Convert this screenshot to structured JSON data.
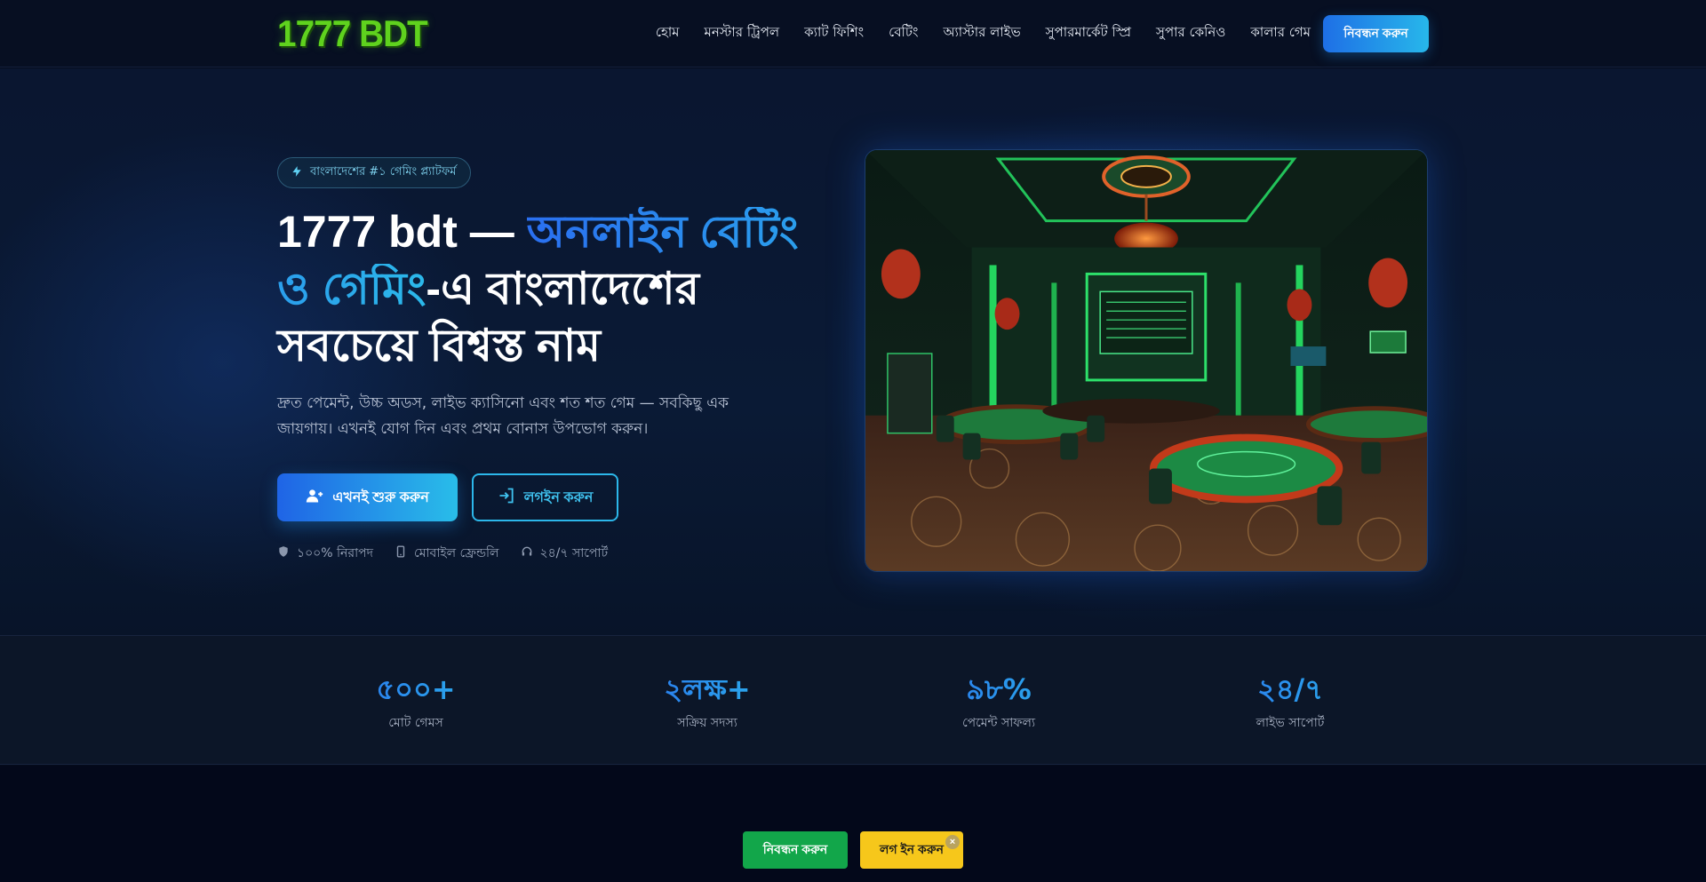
{
  "nav": {
    "logo": "1777 BDT",
    "items": [
      "হোম",
      "মনস্টার ট্রিপল",
      "ক্যাট ফিশিং",
      "বেটিং",
      "অ্যাস্টার লাইভ",
      "সুপারমার্কেট স্প্রি",
      "সুপার কেনিও",
      "কালার গেম"
    ],
    "register_label": "নিবন্ধন করুন"
  },
  "hero": {
    "badge": "বাংলাদেশের #১ গেমিং প্ল্যাটফর্ম",
    "title_part1": "1777 bdt — ",
    "title_highlight": "অনলাইন বেটিং ও গেমিং",
    "title_part2": "-এ বাংলাদেশের সবচেয়ে বিশ্বস্ত নাম",
    "description": "দ্রুত পেমেন্ট, উচ্চ অডস, লাইভ ক্যাসিনো এবং শত শত গেম — সবকিছু এক জায়গায়। এখনই যোগ দিন এবং প্রথম বোনাস উপভোগ করুন।",
    "primary_button": "এখনই শুরু করুন",
    "secondary_button": "লগইন করুন",
    "features": [
      "১০০% নিরাপদ",
      "মোবাইল ফ্রেন্ডলি",
      "২৪/৭ সাপোর্ট"
    ]
  },
  "stats": [
    {
      "value": "৫০০+",
      "label": "মোট গেমস"
    },
    {
      "value": "২লক্ষ+",
      "label": "সক্রিয় সদস্য"
    },
    {
      "value": "৯৮%",
      "label": "পেমেন্ট সাফল্য"
    },
    {
      "value": "২৪/৭",
      "label": "লাইভ সাপোর্ট"
    }
  ],
  "sticky": {
    "register_label": "নিবন্ধন করুন",
    "login_label": "লগ ইন করুন",
    "close_icon": "×"
  },
  "colors": {
    "accent_blue": "#1f64e6",
    "accent_cyan": "#29bde9",
    "sticky_green": "#12a64a",
    "sticky_yellow": "#f6c71b",
    "logo_green": "#5fd21e"
  }
}
